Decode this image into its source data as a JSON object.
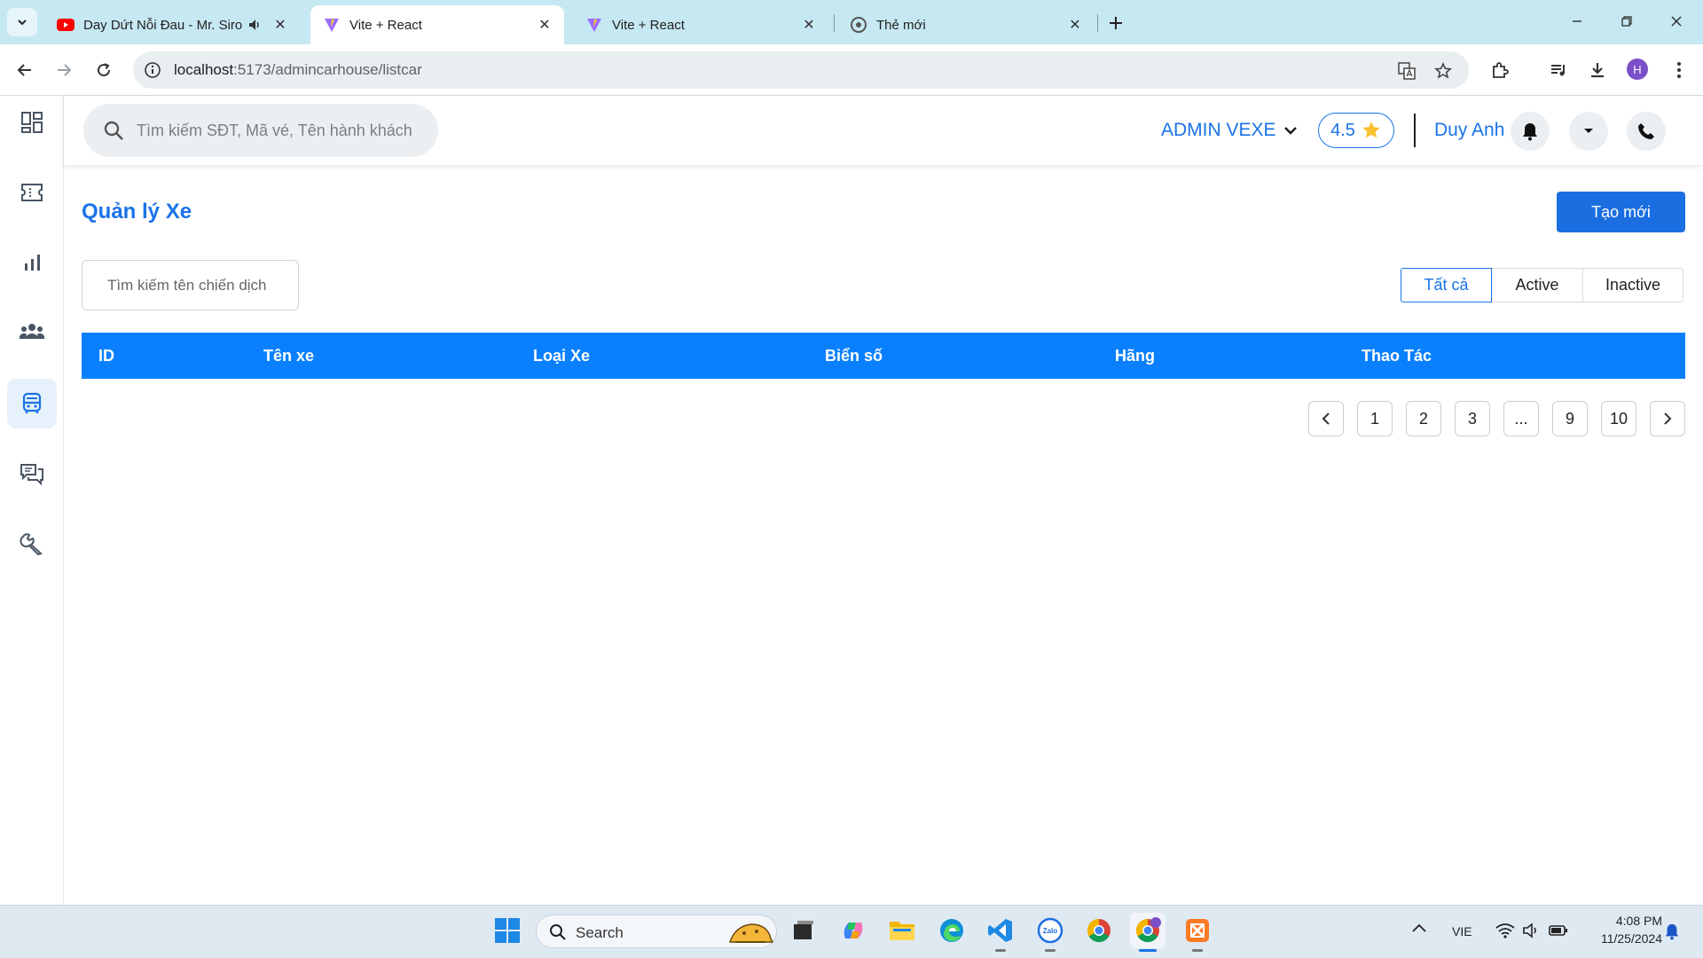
{
  "browser": {
    "tabs": [
      {
        "title": "Day Dứt Nỗi Đau - Mr. Siro",
        "favicon": "youtube-icon",
        "active": false
      },
      {
        "title": "Vite + React",
        "favicon": "vite-icon",
        "active": true
      },
      {
        "title": "Vite + React",
        "favicon": "vite-icon",
        "active": false
      },
      {
        "title": "Thẻ mới",
        "favicon": "chrome-icon",
        "active": false
      }
    ],
    "url_host": "localhost",
    "url_path": ":5173/admincarhouse/listcar",
    "profile_initial": "H"
  },
  "header": {
    "search_placeholder": "Tìm kiếm SĐT, Mã vé, Tên hành khách",
    "company": "ADMIN VEXE",
    "rating": "4.5",
    "username": "Duy Anh"
  },
  "sidebar": {
    "items": [
      {
        "name": "dashboard-icon",
        "active": false
      },
      {
        "name": "ticket-icon",
        "active": false
      },
      {
        "name": "bar-chart-icon",
        "active": false
      },
      {
        "name": "users-icon",
        "active": false
      },
      {
        "name": "bus-icon",
        "active": true
      },
      {
        "name": "chat-icon",
        "active": false
      },
      {
        "name": "wrench-icon",
        "active": false
      }
    ]
  },
  "main": {
    "title": "Quản lý Xe",
    "create_label": "Tạo mới",
    "search_placeholder": "Tìm kiếm tên chiến dịch",
    "filters": [
      "Tất cả",
      "Active",
      "Inactive"
    ],
    "columns": [
      "ID",
      "Tên xe",
      "Loại Xe",
      "Biển số",
      "Hãng",
      "Thao Tác"
    ],
    "pagination": [
      "1",
      "2",
      "3",
      "...",
      "9",
      "10"
    ]
  },
  "taskbar": {
    "search_label": "Search",
    "language": "VIE",
    "time": "4:08 PM",
    "date": "11/25/2024"
  },
  "colors": {
    "accent": "#1a73e8",
    "table_header": "#0a80ff",
    "button": "#1a6ee0",
    "tabstrip": "#c6e8f2"
  }
}
